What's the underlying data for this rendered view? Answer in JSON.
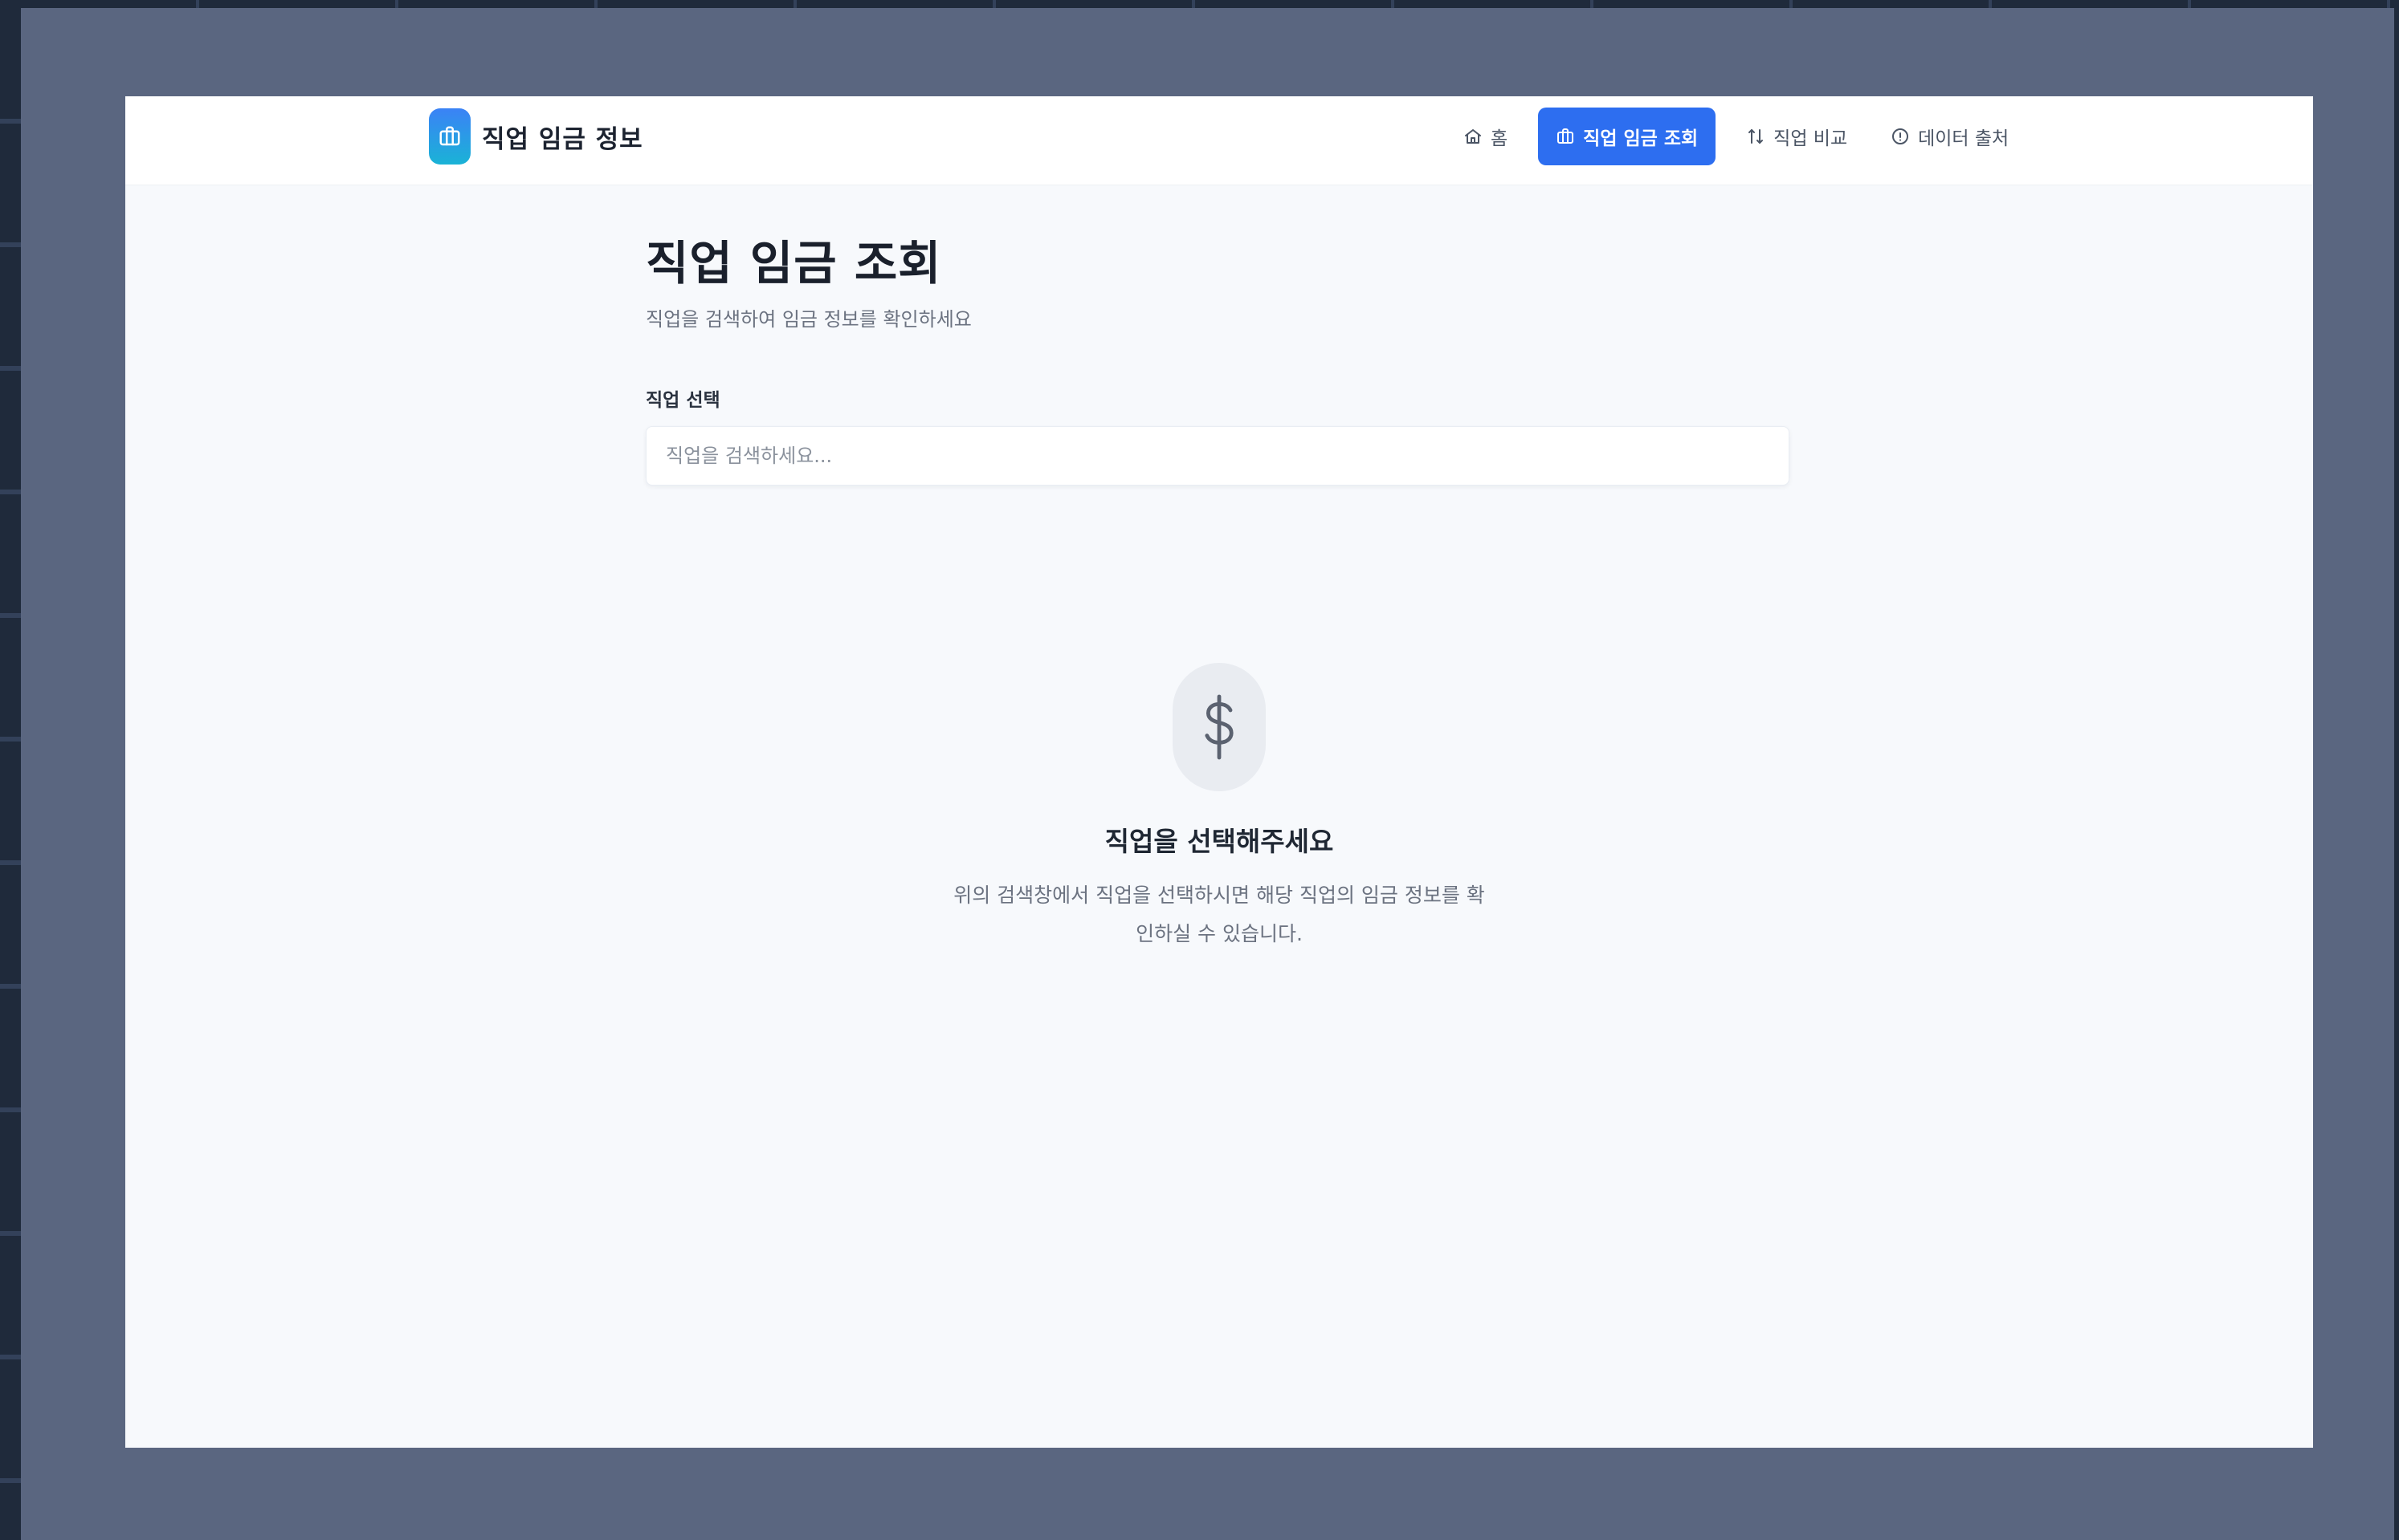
{
  "header": {
    "brand_title": "직업 임금 정보",
    "brand_color": "#2d6ef0"
  },
  "nav": {
    "items": [
      {
        "label": "홈",
        "icon": "home-icon",
        "active": false
      },
      {
        "label": "직업 임금 조회",
        "icon": "briefcase-icon",
        "active": true
      },
      {
        "label": "직업 비교",
        "icon": "compare-arrows-icon",
        "active": false
      },
      {
        "label": "데이터 출처",
        "icon": "info-circle-icon",
        "active": false
      }
    ]
  },
  "main": {
    "title": "직업 임금 조회",
    "subtitle": "직업을 검색하여 임금 정보를 확인하세요",
    "search": {
      "label": "직업 선택",
      "placeholder": "직업을 검색하세요...",
      "value": ""
    }
  },
  "empty_state": {
    "icon": "dollar-icon",
    "title": "직업을 선택해주세요",
    "description": "위의 검색창에서 직업을 선택하시면 해당 직업의 임금 정보를 확인하실 수 있습니다."
  }
}
